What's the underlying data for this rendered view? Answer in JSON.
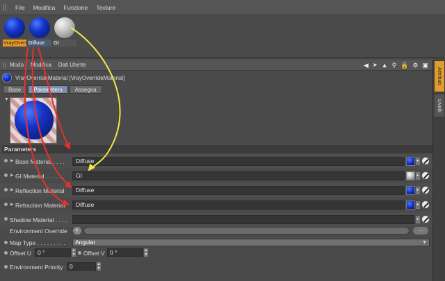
{
  "menu": [
    "File",
    "Modifica",
    "Funzione",
    "Texture"
  ],
  "materials": [
    {
      "label": "VrayOverr",
      "type": "blue",
      "selected": true
    },
    {
      "label": "Diffuse",
      "type": "blue",
      "selected": false
    },
    {
      "label": "GI",
      "type": "gray",
      "selected": false
    }
  ],
  "attr_menu": [
    "Modo",
    "Modifica",
    "Dati Utente"
  ],
  "toolbar_icons": [
    "back-arrow-icon",
    "cursor-icon",
    "up-arrow-icon",
    "search-icon",
    "lock-icon",
    "settings-icon",
    "new-panel-icon"
  ],
  "material_title": "VrayOverrideMaterial [VrayOverrideMaterial]",
  "tabs": [
    {
      "label": "Base",
      "active": false
    },
    {
      "label": "Parameters",
      "active": true
    },
    {
      "label": "Assegna",
      "active": false
    }
  ],
  "section_title": "Parameters",
  "rows": [
    {
      "label": "Base Material . . . .",
      "value": "Diffuse",
      "swatch": "blue"
    },
    {
      "label": "GI Material . . . . . .",
      "value": "GI",
      "swatch": "gray"
    },
    {
      "label": "Reflection Material",
      "value": "Diffuse",
      "swatch": "blue"
    },
    {
      "label": "Refraction Material",
      "value": "Diffuse",
      "swatch": "blue"
    },
    {
      "label": "Shadow Material . . . .",
      "value": "",
      "swatch": "none"
    }
  ],
  "environment": {
    "label": "Environment Override",
    "dots_label": "..."
  },
  "map_type": {
    "label": "Map Type . . . . . . . . .",
    "value": "Angular"
  },
  "offset_u": {
    "label": "Offset U",
    "value": "0 °"
  },
  "offset_v": {
    "label": "Offset V",
    "value": "0 °"
  },
  "priority": {
    "label": "Environment Priority",
    "value": "0"
  },
  "side_tabs": [
    "Attributi",
    "Livelli"
  ],
  "colors": {
    "accent_orange": "#e09b2d",
    "arrow_red": "#e8302a",
    "arrow_yellow": "#f2e84a",
    "active_tab": "#7e8ea8"
  }
}
